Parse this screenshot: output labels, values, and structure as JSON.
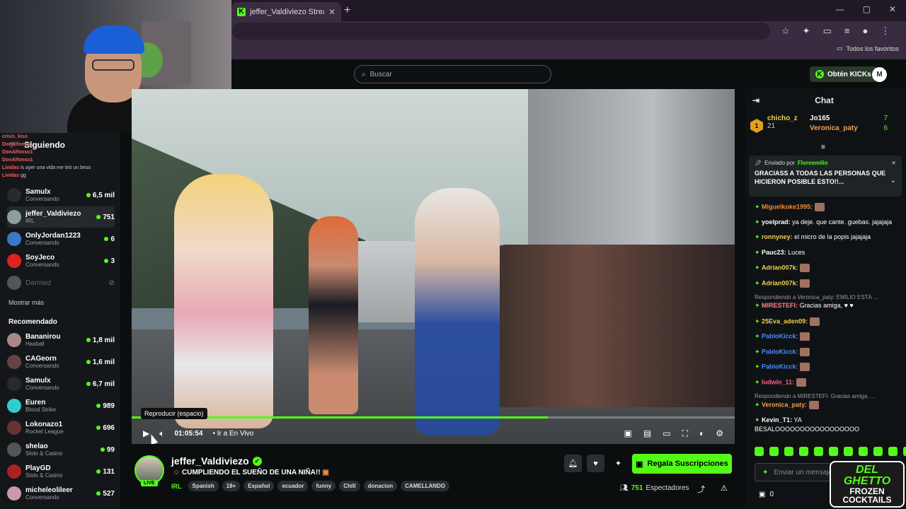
{
  "browser": {
    "tab_title": "jeffer_Valdiviezo Stream - Watch",
    "new_tab": "+",
    "window_controls": [
      "—",
      "▢",
      "✕"
    ],
    "bookmarks_label": "Todos los favoritos"
  },
  "site": {
    "search_placeholder": "Buscar",
    "kicks_button": "Obtén KICKs",
    "profile_initial": "M"
  },
  "overlay_chat": [
    {
      "user": "crisis_kiss",
      "text": ""
    },
    {
      "user": "DonAlfonso1",
      "text": ""
    },
    {
      "user": "DonAlfonso1",
      "text": ""
    },
    {
      "user": "DonAlfonso1",
      "text": ""
    },
    {
      "user": "Lividas",
      "text": "is ayer una vida me tiró un beso"
    },
    {
      "user": "Lividas",
      "text": "gg"
    }
  ],
  "sidebar": {
    "following_title": "Siguiendo",
    "following": [
      {
        "name": "Samulx",
        "category": "Conversando",
        "viewers": "6,5 mil",
        "color": "#2a2a2a"
      },
      {
        "name": "jeffer_Valdiviezo",
        "category": "IRL",
        "viewers": "751",
        "color": "#8aa0a0"
      },
      {
        "name": "OnlyJordan1223",
        "category": "Conversando",
        "viewers": "6",
        "color": "#3a78c8"
      },
      {
        "name": "SoyJeco",
        "category": "Conversando",
        "viewers": "3",
        "color": "#d22"
      },
      {
        "name": "Darmwz",
        "category": "",
        "viewers": "",
        "color": "#555"
      }
    ],
    "show_more": "Mostrar más",
    "recommended_title": "Recomendado",
    "recommended": [
      {
        "name": "Bananirou",
        "category": "Haxball",
        "viewers": "1,8 mil",
        "color": "#a88"
      },
      {
        "name": "CAGeorn",
        "category": "Conversando",
        "viewers": "1,6 mil",
        "color": "#644"
      },
      {
        "name": "Samulx",
        "category": "Conversando",
        "viewers": "6,7 mil",
        "color": "#2a2a2a"
      },
      {
        "name": "Euren",
        "category": "Blood Strike",
        "viewers": "989",
        "color": "#3cc"
      },
      {
        "name": "Lokonazo1",
        "category": "Rocket League",
        "viewers": "696",
        "color": "#633"
      },
      {
        "name": "shelao",
        "category": "Slots & Casino",
        "viewers": "99",
        "color": "#555"
      },
      {
        "name": "PlayGD",
        "category": "Slots & Casino",
        "viewers": "131",
        "color": "#a22"
      },
      {
        "name": "micheleolileer",
        "category": "Conversando",
        "viewers": "527",
        "color": "#c9a"
      }
    ]
  },
  "player": {
    "tooltip": "Reproducir (espacio)",
    "time": "01:05:54",
    "go_live": "Ir a En Vivo",
    "progress_fraction": 0.69
  },
  "stream": {
    "live_badge": "LIVE",
    "name": "jeffer_Valdiviezo",
    "verified": "✓",
    "title": "CUMPLIENDO EL SUEÑO DE UNA NIÑA!!",
    "category": "IRL",
    "tags": [
      "Spanish",
      "18+",
      "Español",
      "ecuador",
      "funny",
      "Chill",
      "donacion",
      "CAMELLANDO"
    ],
    "gift_button": "Regala Suscripciones",
    "viewers_count": "751",
    "viewers_label": "Espectadores"
  },
  "chat": {
    "title": "Chat",
    "leaderboard": [
      {
        "name": "chicho_z",
        "count": "21"
      },
      {
        "name": "Jo165",
        "count": "7"
      },
      {
        "name": "Veronica_paty",
        "count": "6"
      }
    ],
    "pinned_label": "Enviado por",
    "pinned_user": "Floresmilio",
    "pinned_text": "GRACIASS A TODAS LAS PERSONAS QUE HICIERON POSIBLE ESTO!!...",
    "messages": [
      {
        "user": "Miguelkoke1995:",
        "text": "",
        "color": "#f08a3c"
      },
      {
        "user": "yoelprad:",
        "text": "ya deje. que cante. guebas. jajajaja",
        "color": "#ffffff"
      },
      {
        "user": "ronnyney:",
        "text": "el micro de la popis jajajaja",
        "color": "#f0d24a"
      },
      {
        "user": "Pauc23:",
        "text": "Luces",
        "color": "#ffffff"
      },
      {
        "user": "Adrian007k:",
        "text": "",
        "color": "#f0d24a"
      },
      {
        "user": "Adrian007k:",
        "text": "",
        "color": "#f0d24a"
      }
    ],
    "reply1": "Respondiendo a Veronica_paty: EMILIO ESTÁ ...",
    "messages2": [
      {
        "user": "MIRESTEFI:",
        "text": "Gracias amiga, ♥ ♥",
        "color": "#ff8080"
      },
      {
        "user": "25Eva_aden09:",
        "text": "",
        "color": "#f0d24a"
      },
      {
        "user": "PabloKicck:",
        "text": "",
        "color": "#4a8cff"
      },
      {
        "user": "PabloKicck:",
        "text": "",
        "color": "#4a8cff"
      },
      {
        "user": "PabloKicck:",
        "text": "",
        "color": "#4a8cff"
      },
      {
        "user": "ludwin_11:",
        "text": "",
        "color": "#ff6080"
      }
    ],
    "reply2": "Respondiendo a MIRESTEFI: Gracias amiga, ...",
    "messages3": [
      {
        "user": "Veronica_paty:",
        "text": "",
        "color": "#f0a050"
      },
      {
        "user": "Kevin_T1:",
        "text": "YA",
        "color": "#ffffff"
      }
    ],
    "final_line": "BESALOOOOOOOOOOOOOOOOO",
    "input_placeholder": "Enviar un mensaje",
    "points": "0"
  },
  "logo": {
    "line1": "DEL GHETTO",
    "line2": "FROZEN",
    "line3": "COCKTAILS"
  }
}
